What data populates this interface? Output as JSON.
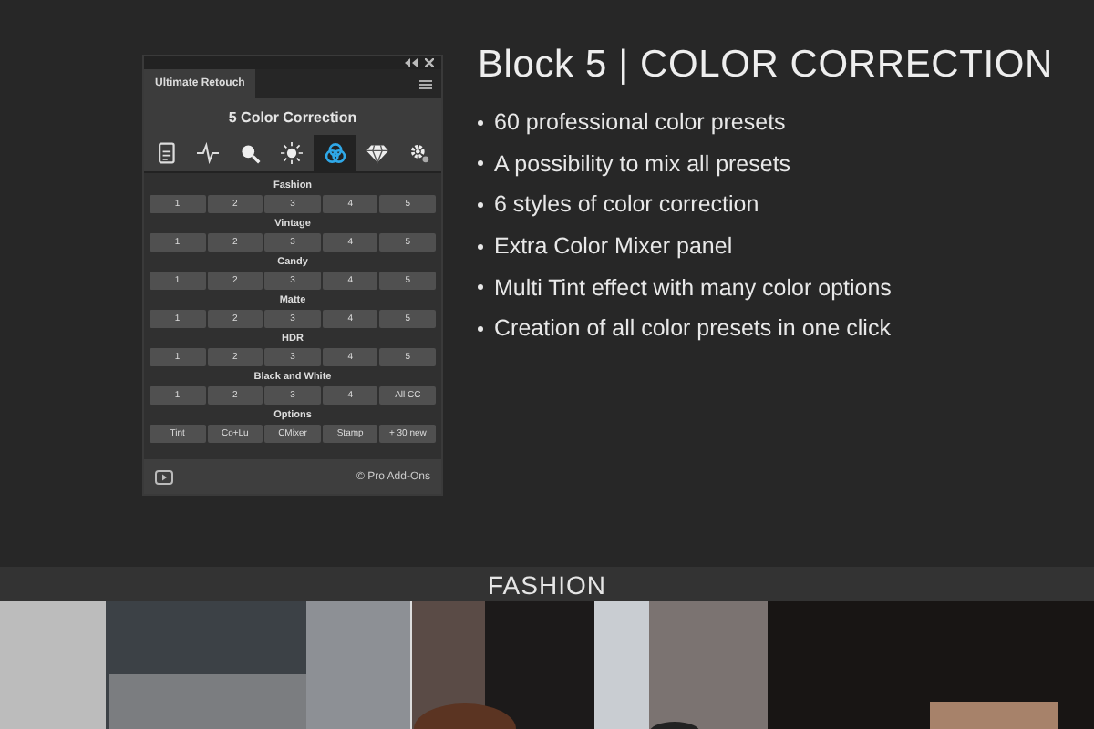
{
  "panel": {
    "tab": "Ultimate Retouch",
    "heading": "5 Color Correction",
    "tools": [
      {
        "kind": "document",
        "selected": false
      },
      {
        "kind": "pulse",
        "selected": false
      },
      {
        "kind": "magnifier",
        "selected": false
      },
      {
        "kind": "sun",
        "selected": false
      },
      {
        "kind": "rings",
        "selected": true
      },
      {
        "kind": "diamond",
        "selected": false
      },
      {
        "kind": "gear",
        "selected": false
      }
    ],
    "sections": [
      {
        "label": "Fashion",
        "buttons": [
          "1",
          "2",
          "3",
          "4",
          "5"
        ]
      },
      {
        "label": "Vintage",
        "buttons": [
          "1",
          "2",
          "3",
          "4",
          "5"
        ]
      },
      {
        "label": "Candy",
        "buttons": [
          "1",
          "2",
          "3",
          "4",
          "5"
        ]
      },
      {
        "label": "Matte",
        "buttons": [
          "1",
          "2",
          "3",
          "4",
          "5"
        ]
      },
      {
        "label": "HDR",
        "buttons": [
          "1",
          "2",
          "3",
          "4",
          "5"
        ]
      },
      {
        "label": "Black and White",
        "buttons": [
          "1",
          "2",
          "3",
          "4",
          "All CC"
        ]
      },
      {
        "label": "Options",
        "buttons": [
          "Tint",
          "Co+Lu",
          "CMixer",
          "Stamp",
          "+ 30 new"
        ]
      }
    ],
    "footer": "© Pro Add-Ons"
  },
  "promo": {
    "title": "Block 5 | COLOR CORRECTION",
    "bullets": [
      "60 professional color presets",
      "A possibility to mix all presets",
      "6 styles of color correction",
      "Extra Color Mixer panel",
      "Multi Tint effect with many color options",
      "Creation of all color presets in one click"
    ]
  },
  "gallery": {
    "title": "FASHION"
  }
}
